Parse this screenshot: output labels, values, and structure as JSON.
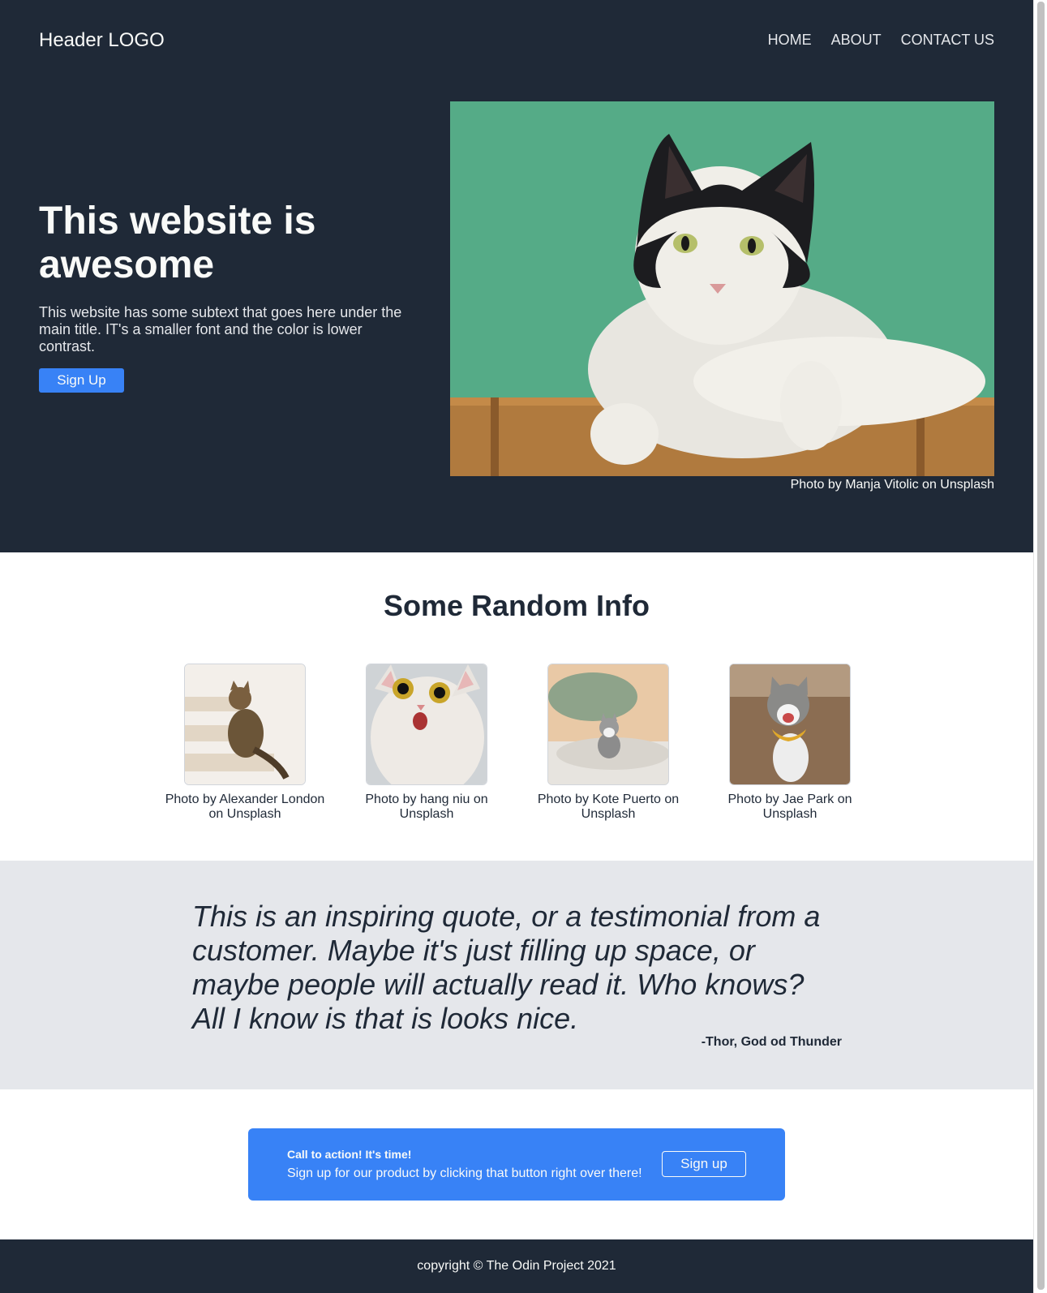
{
  "header": {
    "logo": "Header LOGO",
    "nav": [
      "HOME",
      "ABOUT",
      "CONTACT US"
    ]
  },
  "hero": {
    "title": "This website is awesome",
    "subtitle": "This website has some subtext that goes here under the main title. IT's a smaller font and the color is lower contrast.",
    "button": "Sign Up",
    "image_credit": "Photo by Manja Vitolic on Unsplash"
  },
  "info": {
    "title": "Some Random Info",
    "cards": [
      {
        "caption": "Photo by Alexander London on Unsplash"
      },
      {
        "caption": "Photo by hang niu on Unsplash"
      },
      {
        "caption": "Photo by Kote Puerto on Unsplash"
      },
      {
        "caption": "Photo by Jae Park on Unsplash"
      }
    ]
  },
  "quote": {
    "text": "This is an inspiring quote, or a testimonial from a customer. Maybe it's just filling up space, or maybe people will actually read it. Who knows? All I know is that is looks nice.",
    "author": "-Thor, God od Thunder"
  },
  "cta": {
    "title": "Call to action! It's time!",
    "text": "Sign up for our product by clicking that button right over there!",
    "button": "Sign up"
  },
  "footer": {
    "text": "copyright © The Odin Project 2021"
  },
  "colors": {
    "dark": "#1f2937",
    "accent": "#3882f6",
    "light": "#f9faf8",
    "gray": "#e5e7eb"
  }
}
